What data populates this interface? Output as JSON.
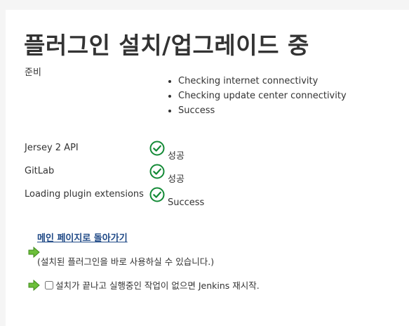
{
  "page": {
    "title": "플러그인 설치/업그레이드 중"
  },
  "preparation": {
    "label": "준비",
    "steps": [
      "Checking internet connectivity",
      "Checking update center connectivity",
      "Success"
    ]
  },
  "plugins": [
    {
      "name": "Jersey 2 API",
      "status": "성공",
      "icon": "check-circle-icon"
    },
    {
      "name": "GitLab",
      "status": "성공",
      "icon": "check-circle-icon"
    },
    {
      "name": "Loading plugin extensions",
      "status": "Success",
      "icon": "check-circle-icon"
    }
  ],
  "actions": {
    "back_link": "메인 페이지로 돌아가기",
    "back_note": "(설치된 플러그인을 바로 사용하실 수 있습니다.)",
    "restart_label": "설치가 끝나고 실행중인 작업이 없으면 Jenkins 재시작."
  },
  "colors": {
    "success_green": "#138a36",
    "arrow_green": "#6cbf3a",
    "link_blue": "#204a87"
  }
}
